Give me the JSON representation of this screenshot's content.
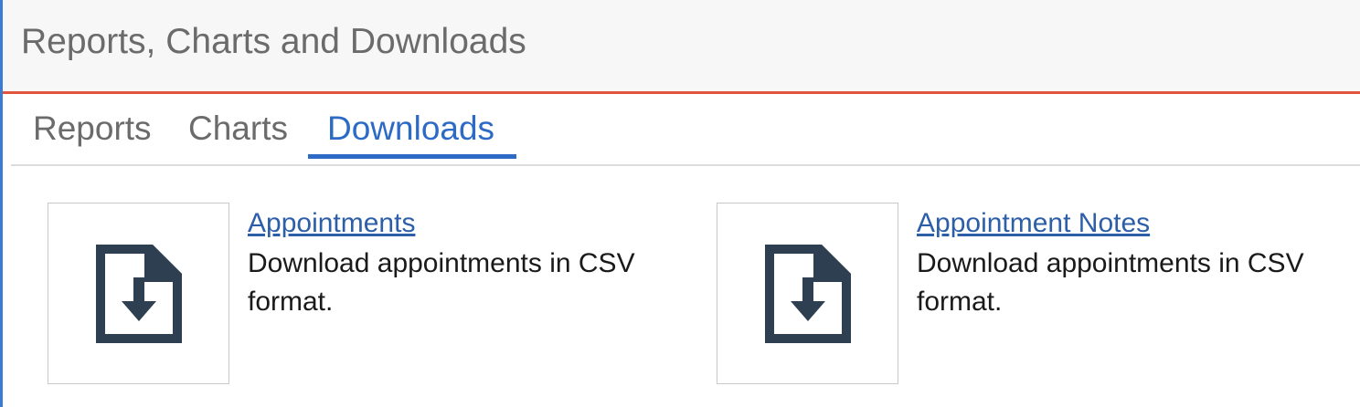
{
  "header": {
    "title": "Reports, Charts and Downloads"
  },
  "tabs": [
    {
      "label": "Reports",
      "active": false
    },
    {
      "label": "Charts",
      "active": false
    },
    {
      "label": "Downloads",
      "active": true
    }
  ],
  "downloads": [
    {
      "title": "Appointments",
      "description": "Download appointments in CSV format.",
      "icon": "file-download-icon"
    },
    {
      "title": "Appointment Notes",
      "description": "Download appointments in CSV format.",
      "icon": "file-download-icon"
    }
  ],
  "colors": {
    "accent": "#2c6ac6",
    "header_border": "#e0553c",
    "icon": "#2f3f52"
  }
}
